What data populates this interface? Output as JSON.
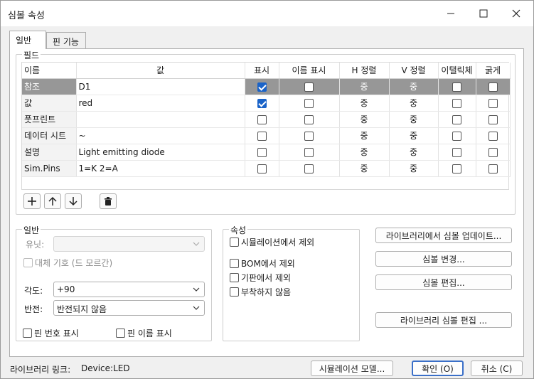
{
  "window": {
    "title": "심볼 속성"
  },
  "tabs": [
    {
      "label": "일반"
    },
    {
      "label": "핀 기능"
    }
  ],
  "fields": {
    "group_label": "필드",
    "columns": [
      "이름",
      "값",
      "표시",
      "이름 표시",
      "H 정렬",
      "V 정렬",
      "이탤릭체",
      "굵게"
    ],
    "rows": [
      {
        "name": "참조",
        "value": "D1",
        "show": true,
        "show_name": false,
        "h_align": "중",
        "v_align": "중",
        "italic": false,
        "bold": false,
        "selected": true
      },
      {
        "name": "값",
        "value": "red",
        "show": true,
        "show_name": false,
        "h_align": "중",
        "v_align": "중",
        "italic": false,
        "bold": false
      },
      {
        "name": "풋프린트",
        "value": "",
        "show": false,
        "show_name": false,
        "h_align": "중",
        "v_align": "중",
        "italic": false,
        "bold": false
      },
      {
        "name": "데이터 시트",
        "value": "~",
        "show": false,
        "show_name": false,
        "h_align": "중",
        "v_align": "중",
        "italic": false,
        "bold": false
      },
      {
        "name": "설명",
        "value": "Light emitting diode",
        "show": false,
        "show_name": false,
        "h_align": "중",
        "v_align": "중",
        "italic": false,
        "bold": false
      },
      {
        "name": "Sim.Pins",
        "value": "1=K 2=A",
        "show": false,
        "show_name": false,
        "h_align": "중",
        "v_align": "중",
        "italic": false,
        "bold": false
      }
    ]
  },
  "general": {
    "group_label": "일반",
    "unit_label": "유닛:",
    "alt_symbol_label": "대체 기호 (드 모르간)",
    "angle_label": "각도:",
    "angle_value": "+90",
    "mirror_label": "반전:",
    "mirror_value": "반전되지 않음",
    "show_pin_numbers": "핀 번호 표시",
    "show_pin_names": "핀 이름 표시"
  },
  "attributes": {
    "group_label": "속성",
    "exclude_sim": "시뮬레이션에서 제외",
    "exclude_bom": "BOM에서 제외",
    "exclude_board": "기판에서 제외",
    "dnp": "부착하지 않음"
  },
  "actions": {
    "update_from_lib": "라이브러리에서 심볼 업데이트...",
    "change_symbol": "심볼 변경...",
    "edit_symbol": "심볼 편집...",
    "edit_lib_symbol": "라이브러리 심볼 편집 ..."
  },
  "footer": {
    "lib_link_label": "라이브러리 링크:",
    "lib_link_value": "Device:LED",
    "sim_model": "시뮬레이션 모델...",
    "ok": "확인 (O)",
    "cancel": "취소 (C)"
  },
  "colors": {
    "accent": "#1a63c8",
    "selected_row": "#979797"
  }
}
